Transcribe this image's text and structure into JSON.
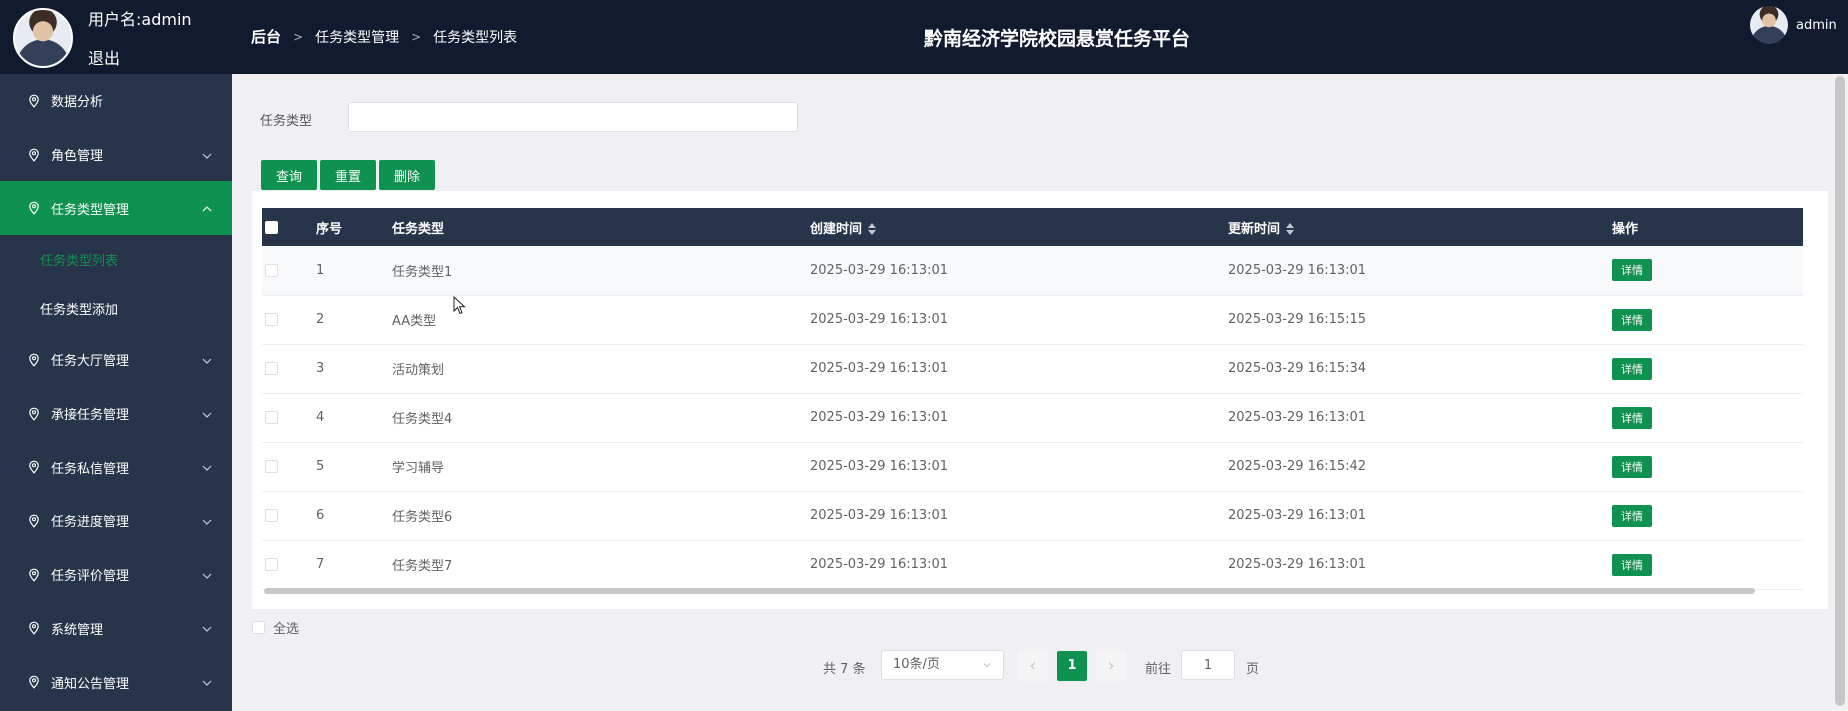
{
  "user": {
    "name_label": "用户名:admin",
    "logout": "退出"
  },
  "header": {
    "breadcrumb": [
      "后台",
      "任务类型管理",
      "任务类型列表"
    ],
    "title": "黔南经济学院校园悬赏任务平台",
    "username": "admin"
  },
  "sidebar": {
    "items": [
      {
        "label": "数据分析",
        "icon": "location-pin-icon",
        "expandable": false
      },
      {
        "label": "角色管理",
        "icon": "location-pin-icon",
        "expandable": true
      },
      {
        "label": "任务类型管理",
        "icon": "location-pin-icon",
        "expandable": true,
        "active": true,
        "children": [
          "任务类型列表",
          "任务类型添加"
        ]
      },
      {
        "label": "任务大厅管理",
        "icon": "location-pin-icon",
        "expandable": true
      },
      {
        "label": "承接任务管理",
        "icon": "location-pin-icon",
        "expandable": true
      },
      {
        "label": "任务私信管理",
        "icon": "location-pin-icon",
        "expandable": true
      },
      {
        "label": "任务进度管理",
        "icon": "location-pin-icon",
        "expandable": true
      },
      {
        "label": "任务评价管理",
        "icon": "location-pin-icon",
        "expandable": true
      },
      {
        "label": "系统管理",
        "icon": "location-pin-icon",
        "expandable": true
      },
      {
        "label": "通知公告管理",
        "icon": "location-pin-icon",
        "expandable": true
      }
    ]
  },
  "search": {
    "label": "任务类型",
    "value": "",
    "placeholder": ""
  },
  "buttons": {
    "query": "查询",
    "reset": "重置",
    "delete": "删除"
  },
  "table": {
    "headers": {
      "index": "序号",
      "type": "任务类型",
      "created": "创建时间",
      "updated": "更新时间",
      "action": "操作"
    },
    "action_label": "详情",
    "rows": [
      {
        "index": "1",
        "type": "任务类型1",
        "created": "2025-03-29 16:13:01",
        "updated": "2025-03-29 16:13:01"
      },
      {
        "index": "2",
        "type": "AA类型",
        "created": "2025-03-29 16:13:01",
        "updated": "2025-03-29 16:15:15"
      },
      {
        "index": "3",
        "type": "活动策划",
        "created": "2025-03-29 16:13:01",
        "updated": "2025-03-29 16:15:34"
      },
      {
        "index": "4",
        "type": "任务类型4",
        "created": "2025-03-29 16:13:01",
        "updated": "2025-03-29 16:13:01"
      },
      {
        "index": "5",
        "type": "学习辅导",
        "created": "2025-03-29 16:13:01",
        "updated": "2025-03-29 16:15:42"
      },
      {
        "index": "6",
        "type": "任务类型6",
        "created": "2025-03-29 16:13:01",
        "updated": "2025-03-29 16:13:01"
      },
      {
        "index": "7",
        "type": "任务类型7",
        "created": "2025-03-29 16:13:01",
        "updated": "2025-03-29 16:13:01"
      }
    ]
  },
  "select_all": "全选",
  "pagination": {
    "total": "共 7 条",
    "page_size": "10条/页",
    "current": "1",
    "goto_label": "前往",
    "goto_value": "1",
    "page_suffix": "页"
  },
  "colors": {
    "accent": "#0f9150",
    "header_bg": "#111a2e",
    "sidebar_bg": "#273449"
  }
}
